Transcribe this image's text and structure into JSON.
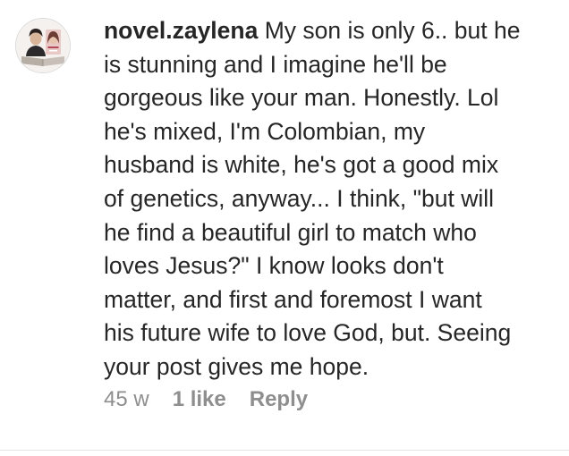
{
  "comment": {
    "username": "novel.zaylena",
    "avatar_icon": "profile-photo-couple",
    "lines": [
      "My son is only 6.. but he",
      "is stunning and I imagine he'll be",
      "gorgeous like your man. Honestly. Lol",
      "he's mixed, I'm Colombian, my",
      "husband is white, he's got a good mix",
      "of genetics, anyway... I think, \"but will",
      "he find a beautiful girl to match who",
      "loves Jesus?\" I know looks don't",
      "matter, and first and foremost I want",
      "his future wife to love God, but. Seeing",
      "your post gives me hope."
    ],
    "time": "45 w",
    "likes": "1 like",
    "reply": "Reply"
  },
  "colors": {
    "text": "#262626",
    "secondary": "#8e8e8e",
    "divider": "#e4e4e4"
  }
}
